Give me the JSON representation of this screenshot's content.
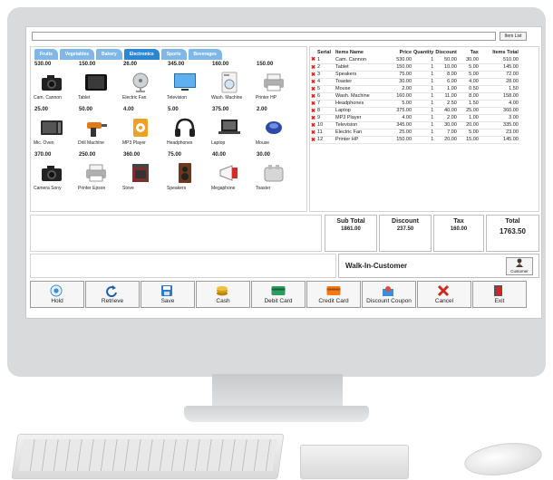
{
  "top": {
    "search_value": "",
    "item_list_label": "Item List"
  },
  "categories": [
    "Fruits",
    "Vegetables",
    "Bakery",
    "Electronics",
    "Sports",
    "Beverages"
  ],
  "active_category": "Electronics",
  "products": [
    {
      "price": "530.00",
      "name": "Cam. Cannon",
      "icon": "camera-icon"
    },
    {
      "price": "150.00",
      "name": "Tablet",
      "icon": "tablet-icon"
    },
    {
      "price": "26.00",
      "name": "Electric Fan",
      "icon": "fan-icon"
    },
    {
      "price": "345.00",
      "name": "Television",
      "icon": "television-icon"
    },
    {
      "price": "160.00",
      "name": "Wash. Machine",
      "icon": "washing-machine-icon"
    },
    {
      "price": "150.00",
      "name": "Printer HP",
      "icon": "printer-icon"
    },
    {
      "price": "25.00",
      "name": "Mic. Oven",
      "icon": "microwave-icon"
    },
    {
      "price": "50.00",
      "name": "Drill Machine",
      "icon": "drill-icon"
    },
    {
      "price": "4.00",
      "name": "MP3 Player",
      "icon": "mp3-player-icon"
    },
    {
      "price": "5.00",
      "name": "Headphones",
      "icon": "headphones-icon"
    },
    {
      "price": "375.00",
      "name": "Laptop",
      "icon": "laptop-icon"
    },
    {
      "price": "2.00",
      "name": "Mouse",
      "icon": "mouse-icon"
    },
    {
      "price": "370.00",
      "name": "Camera Sony",
      "icon": "camera-icon"
    },
    {
      "price": "250.00",
      "name": "Printer Epson",
      "icon": "printer-icon"
    },
    {
      "price": "360.00",
      "name": "Stove",
      "icon": "stove-icon"
    },
    {
      "price": "75.00",
      "name": "Speakers",
      "icon": "speaker-icon"
    },
    {
      "price": "40.00",
      "name": "Megaphone",
      "icon": "megaphone-icon"
    },
    {
      "price": "30.00",
      "name": "Toaster",
      "icon": "toaster-icon"
    }
  ],
  "order": {
    "headers": [
      "Serial",
      "Items Name",
      "Price",
      "Quantity",
      "Discount",
      "Tax",
      "Items Total"
    ],
    "rows": [
      [
        "1",
        "Cam. Cannon",
        "530.00",
        "1",
        "50.00",
        "30.00",
        "510.00"
      ],
      [
        "2",
        "Tablet",
        "150.00",
        "1",
        "10.00",
        "5.00",
        "145.00"
      ],
      [
        "3",
        "Speakers",
        "75.00",
        "1",
        "8.00",
        "5.00",
        "72.00"
      ],
      [
        "4",
        "Toaster",
        "30.00",
        "1",
        "6.00",
        "4.00",
        "28.00"
      ],
      [
        "5",
        "Mouse",
        "2.00",
        "1",
        "1.00",
        "0.50",
        "1.50"
      ],
      [
        "6",
        "Wash. Machine",
        "160.00",
        "1",
        "11.00",
        "8.00",
        "158.00"
      ],
      [
        "7",
        "Headphones",
        "5.00",
        "1",
        "2.50",
        "1.50",
        "4.00"
      ],
      [
        "8",
        "Laptop",
        "375.00",
        "1",
        "40.00",
        "25.00",
        "360.00"
      ],
      [
        "9",
        "MP3 Player",
        "4.00",
        "1",
        "2.00",
        "1.00",
        "3.00"
      ],
      [
        "10",
        "Television",
        "345.00",
        "1",
        "30.00",
        "20.00",
        "335.00"
      ],
      [
        "11",
        "Electric Fan",
        "25.00",
        "1",
        "7.00",
        "5.00",
        "23.00"
      ],
      [
        "12",
        "Printer HP",
        "150.00",
        "1",
        "20.00",
        "15.00",
        "145.00"
      ]
    ]
  },
  "totals": {
    "subtotal_label": "Sub Total",
    "subtotal": "1861.00",
    "discount_label": "Discount",
    "discount": "237.50",
    "tax_label": "Tax",
    "tax": "160.00",
    "total_label": "Total",
    "total": "1763.50"
  },
  "customer": {
    "name": "Walk-In-Customer",
    "button_label": "Customer"
  },
  "actions": [
    {
      "label": "Hold",
      "icon": "hold-icon"
    },
    {
      "label": "Retrieve",
      "icon": "retrieve-icon"
    },
    {
      "label": "Save",
      "icon": "save-icon"
    },
    {
      "label": "Cash",
      "icon": "cash-icon"
    },
    {
      "label": "Debit Card",
      "icon": "debit-card-icon"
    },
    {
      "label": "Credit Card",
      "icon": "credit-card-icon"
    },
    {
      "label": "Discount Coupon",
      "icon": "coupon-icon"
    },
    {
      "label": "Cancel",
      "icon": "cancel-icon"
    },
    {
      "label": "Exit",
      "icon": "exit-icon"
    }
  ],
  "colors": {
    "tab": "#7fb8e6",
    "tab_active": "#2f86d0",
    "remove": "#d0281f"
  }
}
